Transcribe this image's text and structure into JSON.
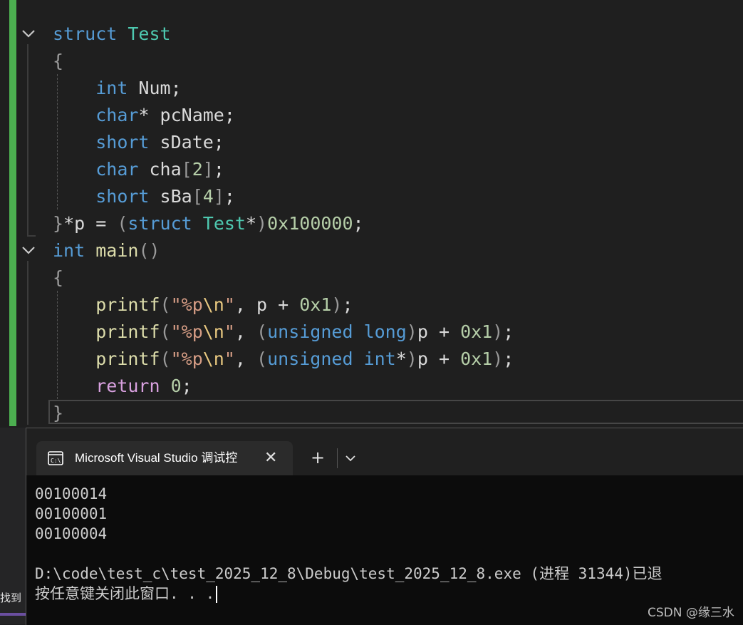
{
  "editor": {
    "lines": [
      {
        "tokens": [
          {
            "t": "struct",
            "c": "kw"
          },
          {
            "t": " ",
            "c": ""
          },
          {
            "t": "Test",
            "c": "ty"
          }
        ]
      },
      {
        "tokens": [
          {
            "t": "{",
            "c": "br"
          }
        ]
      },
      {
        "tokens": [
          {
            "t": "    ",
            "c": ""
          },
          {
            "t": "int",
            "c": "kw"
          },
          {
            "t": " Num;",
            "c": ""
          }
        ]
      },
      {
        "tokens": [
          {
            "t": "    ",
            "c": ""
          },
          {
            "t": "char",
            "c": "kw"
          },
          {
            "t": "* pcName;",
            "c": ""
          }
        ]
      },
      {
        "tokens": [
          {
            "t": "    ",
            "c": ""
          },
          {
            "t": "short",
            "c": "kw"
          },
          {
            "t": " sDate;",
            "c": ""
          }
        ]
      },
      {
        "tokens": [
          {
            "t": "    ",
            "c": ""
          },
          {
            "t": "char",
            "c": "kw"
          },
          {
            "t": " cha",
            "c": ""
          },
          {
            "t": "[",
            "c": "br"
          },
          {
            "t": "2",
            "c": "nm"
          },
          {
            "t": "]",
            "c": "br"
          },
          {
            "t": ";",
            "c": ""
          }
        ]
      },
      {
        "tokens": [
          {
            "t": "    ",
            "c": ""
          },
          {
            "t": "short",
            "c": "kw"
          },
          {
            "t": " sBa",
            "c": ""
          },
          {
            "t": "[",
            "c": "br"
          },
          {
            "t": "4",
            "c": "nm"
          },
          {
            "t": "]",
            "c": "br"
          },
          {
            "t": ";",
            "c": ""
          }
        ]
      },
      {
        "tokens": [
          {
            "t": "}",
            "c": "br"
          },
          {
            "t": "*p = ",
            "c": ""
          },
          {
            "t": "(",
            "c": "br"
          },
          {
            "t": "struct",
            "c": "kw"
          },
          {
            "t": " ",
            "c": ""
          },
          {
            "t": "Test",
            "c": "ty"
          },
          {
            "t": "*",
            "c": ""
          },
          {
            "t": ")",
            "c": "br"
          },
          {
            "t": "0x100000",
            "c": "nm"
          },
          {
            "t": ";",
            "c": ""
          }
        ]
      },
      {
        "tokens": [
          {
            "t": "int",
            "c": "kw"
          },
          {
            "t": " ",
            "c": ""
          },
          {
            "t": "main",
            "c": "fn"
          },
          {
            "t": "()",
            "c": "br"
          }
        ]
      },
      {
        "tokens": [
          {
            "t": "{",
            "c": "br"
          }
        ]
      },
      {
        "tokens": [
          {
            "t": "    ",
            "c": ""
          },
          {
            "t": "printf",
            "c": "fn"
          },
          {
            "t": "(",
            "c": "br"
          },
          {
            "t": "\"%p",
            "c": "st"
          },
          {
            "t": "\\n",
            "c": "es"
          },
          {
            "t": "\"",
            "c": "st"
          },
          {
            "t": ", p + ",
            "c": ""
          },
          {
            "t": "0x1",
            "c": "nm"
          },
          {
            "t": ")",
            "c": "br"
          },
          {
            "t": ";",
            "c": ""
          }
        ]
      },
      {
        "tokens": [
          {
            "t": "    ",
            "c": ""
          },
          {
            "t": "printf",
            "c": "fn"
          },
          {
            "t": "(",
            "c": "br"
          },
          {
            "t": "\"%p",
            "c": "st"
          },
          {
            "t": "\\n",
            "c": "es"
          },
          {
            "t": "\"",
            "c": "st"
          },
          {
            "t": ", ",
            "c": ""
          },
          {
            "t": "(",
            "c": "br"
          },
          {
            "t": "unsigned",
            "c": "kw"
          },
          {
            "t": " ",
            "c": ""
          },
          {
            "t": "long",
            "c": "kw"
          },
          {
            "t": ")",
            "c": "br"
          },
          {
            "t": "p + ",
            "c": ""
          },
          {
            "t": "0x1",
            "c": "nm"
          },
          {
            "t": ")",
            "c": "br"
          },
          {
            "t": ";",
            "c": ""
          }
        ]
      },
      {
        "tokens": [
          {
            "t": "    ",
            "c": ""
          },
          {
            "t": "printf",
            "c": "fn"
          },
          {
            "t": "(",
            "c": "br"
          },
          {
            "t": "\"%p",
            "c": "st"
          },
          {
            "t": "\\n",
            "c": "es"
          },
          {
            "t": "\"",
            "c": "st"
          },
          {
            "t": ", ",
            "c": ""
          },
          {
            "t": "(",
            "c": "br"
          },
          {
            "t": "unsigned",
            "c": "kw"
          },
          {
            "t": " ",
            "c": ""
          },
          {
            "t": "int",
            "c": "kw"
          },
          {
            "t": "*",
            "c": ""
          },
          {
            "t": ")",
            "c": "br"
          },
          {
            "t": "p + ",
            "c": ""
          },
          {
            "t": "0x1",
            "c": "nm"
          },
          {
            "t": ")",
            "c": "br"
          },
          {
            "t": ";",
            "c": ""
          }
        ]
      },
      {
        "tokens": [
          {
            "t": "    ",
            "c": ""
          },
          {
            "t": "return",
            "c": "ct"
          },
          {
            "t": " ",
            "c": ""
          },
          {
            "t": "0",
            "c": "nm"
          },
          {
            "t": ";",
            "c": ""
          }
        ]
      },
      {
        "tokens": [
          {
            "t": "}",
            "c": "br"
          }
        ]
      }
    ]
  },
  "left_panel": {
    "find_label": "找到"
  },
  "terminal": {
    "tab_title": "Microsoft Visual Studio 调试控",
    "tab_close_glyph": "✕",
    "new_tab_glyph": "+",
    "output_lines": [
      "00100014",
      "00100001",
      "00100004",
      "",
      "D:\\code\\test_c\\test_2025_12_8\\Debug\\test_2025_12_8.exe (进程 31344)已退",
      "按任意键关闭此窗口. . ."
    ]
  },
  "watermark": "CSDN @缘三水",
  "colors": {
    "keyword": "#569cd6",
    "type": "#4ec9b0",
    "control": "#d8a0df",
    "string": "#d69d85",
    "escape": "#e8c880",
    "number": "#b5cea8",
    "function": "#dcdcaa",
    "change_bar": "#4caf50"
  }
}
